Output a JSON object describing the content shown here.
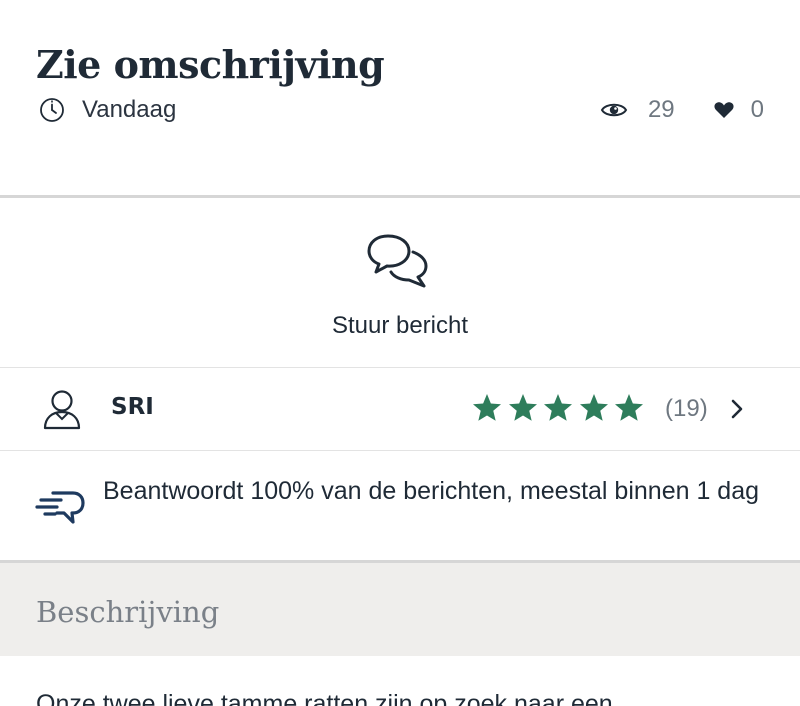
{
  "listing": {
    "title": "Zie omschrijving",
    "date": "Vandaag",
    "views": "29",
    "likes": "0"
  },
  "actions": {
    "message_label": "Stuur bericht"
  },
  "seller": {
    "name": "SRI",
    "rating_stars": 5,
    "review_count": "(19)"
  },
  "response": {
    "text": "Beantwoordt 100% van de berichten, meestal binnen 1 dag"
  },
  "description": {
    "header": "Beschrijving",
    "text": "Onze twee lieve tamme ratten zijn op zoek naar een"
  },
  "icons": {
    "clock": "clock-icon",
    "views": "eye-icon",
    "likes": "heart-icon",
    "message": "chat-bubbles-icon",
    "seller": "user-icon",
    "rating": "star-icon",
    "more": "chevron-right-icon",
    "response": "fast-reply-icon"
  },
  "colors": {
    "text_primary": "#1f2a36",
    "text_muted": "#6e7780",
    "star_green": "#2e7d5b",
    "icon_blue": "#1e3a5f",
    "section_bg": "#efeeec",
    "divider": "#d6d6d6"
  }
}
